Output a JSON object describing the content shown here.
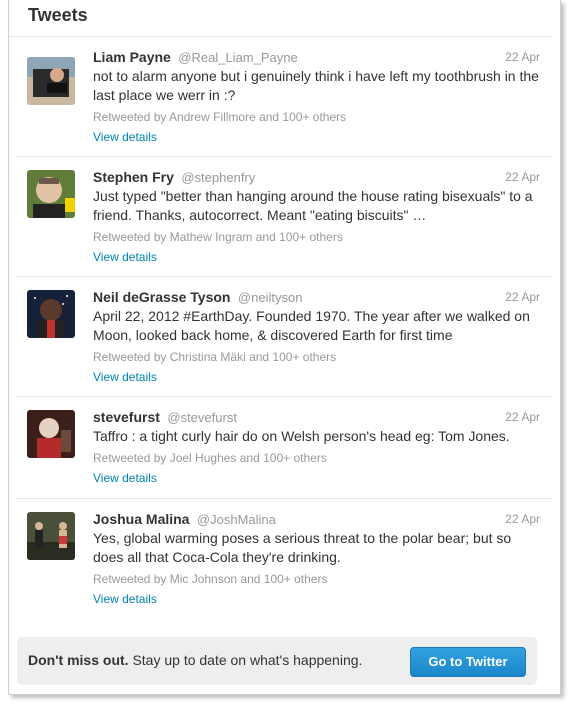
{
  "header": {
    "title": "Tweets"
  },
  "tweets": [
    {
      "fullname": "Liam Payne",
      "username": "@Real_Liam_Payne",
      "time": "22 Apr",
      "text": "not to alarm anyone but i genuinely think i have left my toothbrush in the last place we werr in :?",
      "retweeted_by": "Retweeted by Andrew Fillmore and 100+ others",
      "details": "View details"
    },
    {
      "fullname": "Stephen Fry",
      "username": "@stephenfry",
      "time": "22 Apr",
      "text": "Just typed \"better than hanging around the house rating bisexuals\" to a friend. Thanks, autocorrect. Meant \"eating biscuits\" …",
      "retweeted_by": "Retweeted by Mathew Ingram and 100+ others",
      "details": "View details"
    },
    {
      "fullname": "Neil deGrasse Tyson",
      "username": "@neiltyson",
      "time": "22 Apr",
      "text": "April 22, 2012 #EarthDay. Founded 1970. The year after we walked on Moon, looked back home, & discovered Earth for first time",
      "retweeted_by": "Retweeted by Christina Mäki and 100+ others",
      "details": "View details"
    },
    {
      "fullname": "stevefurst",
      "username": "@stevefurst",
      "time": "22 Apr",
      "text": "Taffro : a tight curly hair do on Welsh person's head eg: Tom Jones.",
      "retweeted_by": "Retweeted by Joel Hughes and 100+ others",
      "details": "View details"
    },
    {
      "fullname": "Joshua Malina",
      "username": "@JoshMalina",
      "time": "22 Apr",
      "text": "Yes, global warming poses a serious threat to the polar bear; but so does all that Coca-Cola they're drinking.",
      "retweeted_by": "Retweeted by Mic Johnson and 100+ others",
      "details": "View details"
    }
  ],
  "banner": {
    "bold": "Don't miss out.",
    "text": " Stay up to date on what's happening.",
    "button": "Go to Twitter"
  },
  "colors": {
    "link": "#0084b4",
    "button": "#1b86c9",
    "muted": "#999999"
  }
}
